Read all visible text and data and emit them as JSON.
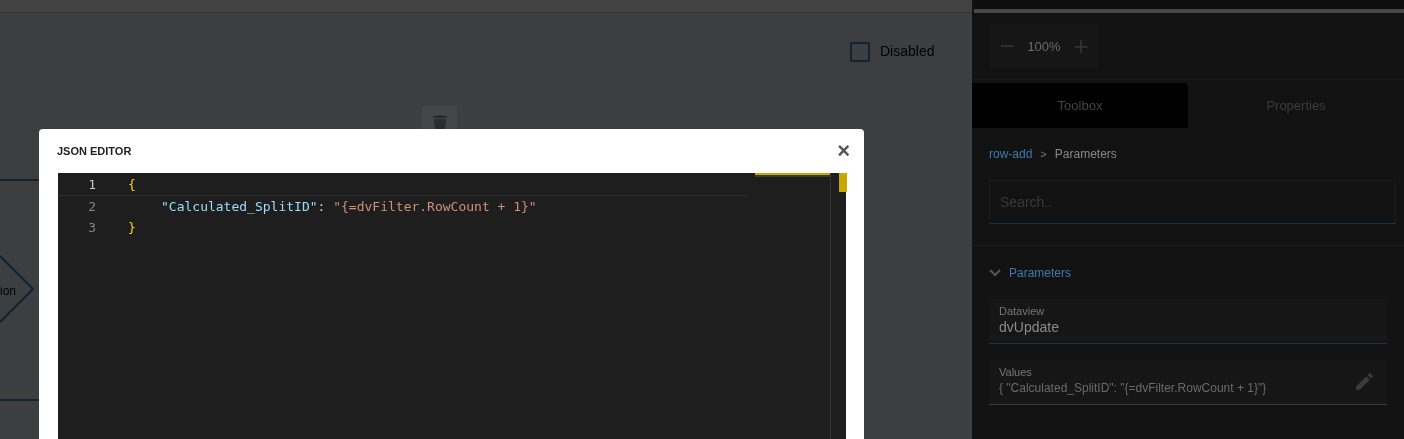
{
  "canvas": {
    "disabled_checkbox": {
      "label": "Disabled",
      "checked": false
    },
    "node_label": "ion"
  },
  "dialog": {
    "title": "JSON EDITOR",
    "close": "×",
    "lines": [
      {
        "number": "1",
        "tokens": [
          {
            "kind": "brace",
            "text": "{"
          }
        ]
      },
      {
        "number": "2",
        "tokens": [
          {
            "kind": "key",
            "text": "\"Calculated_SplitID\""
          },
          {
            "kind": "punct",
            "text": ": "
          },
          {
            "kind": "string",
            "text": "\"{=dvFilter.RowCount + 1}\""
          }
        ]
      },
      {
        "number": "3",
        "tokens": [
          {
            "kind": "brace",
            "text": "}"
          }
        ]
      }
    ]
  },
  "panel": {
    "zoom": {
      "minus": "−",
      "value": "100%",
      "plus": "+"
    },
    "tabs": [
      {
        "label": "Toolbox",
        "selected": true
      },
      {
        "label": "Properties",
        "selected": false
      }
    ],
    "breadcrumb": [
      {
        "label": "row-add",
        "link": true
      },
      {
        "label": ">",
        "link": false
      },
      {
        "label": "Parameters",
        "link": false
      }
    ],
    "search": {
      "placeholder": "Search.."
    },
    "section": {
      "title": "Parameters",
      "expanded": true
    },
    "fields": [
      {
        "label": "Dataview",
        "value": "dvUpdate",
        "kind": "text"
      },
      {
        "label": "Values",
        "value": "{ \"Calculated_SplitID\": \"{=dvFilter.RowCount + 1}\"}",
        "kind": "edit"
      }
    ]
  }
}
